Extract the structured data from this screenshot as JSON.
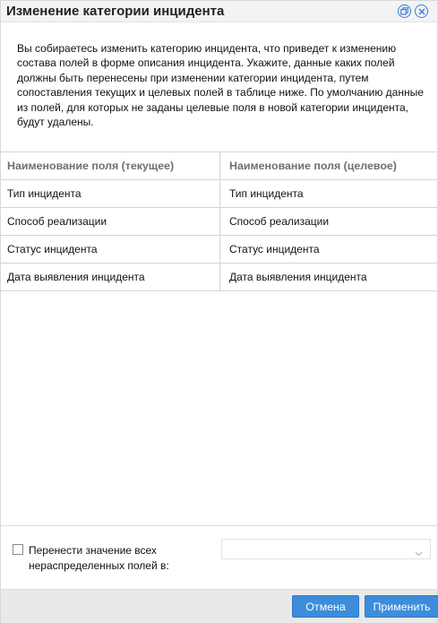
{
  "dialog": {
    "title": "Изменение категории инцидента",
    "intro": "Вы собираетесь изменить категорию инцидента, что приведет к изменению состава полей в форме описания инцидента. Укажите, данные каких полей должны быть перенесены при изменении категории инцидента, путем сопоставления текущих и целевых полей в таблице ниже. По умолчанию данные из полей, для которых не заданы целевые поля в новой категории инцидента, будут удалены."
  },
  "grid": {
    "columns": [
      "Наименование поля (текущее)",
      "Наименование поля (целевое)"
    ],
    "rows": [
      [
        "Тип инцидента",
        "Тип инцидента"
      ],
      [
        "Способ реализации",
        "Способ реализации"
      ],
      [
        "Статус инцидента",
        "Статус инцидента"
      ],
      [
        "Дата выявления инцидента",
        "Дата выявления инцидента"
      ]
    ]
  },
  "move_all": {
    "label": "Перенести значение всех нераспределенных полей в:",
    "checked": false,
    "select_value": ""
  },
  "footer": {
    "cancel_label": "Отмена",
    "apply_label": "Применить"
  },
  "icons": {
    "title_icons": [
      "restore-icon",
      "close-icon"
    ]
  },
  "colors": {
    "accent": "#3d8ddb",
    "icon_blue": "#3b7dd8"
  }
}
